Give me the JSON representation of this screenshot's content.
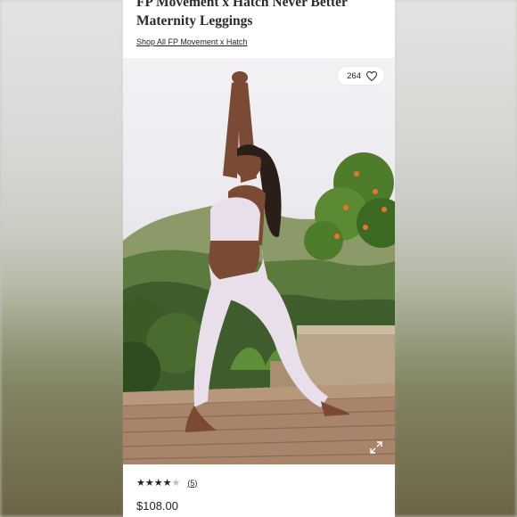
{
  "product": {
    "title": "FP Movement x Hatch Never Better Maternity Leggings",
    "shop_all_label": "Shop All FP Movement x Hatch",
    "likes": "264",
    "rating": 4,
    "rating_max": 5,
    "review_count": "(5)",
    "price": "$108.00"
  },
  "icons": {
    "like": "heart-icon",
    "expand": "expand-icon",
    "star": "star-icon"
  },
  "colors": {
    "text": "#222222",
    "card": "#ffffff",
    "legging": "#e8dfeb"
  }
}
